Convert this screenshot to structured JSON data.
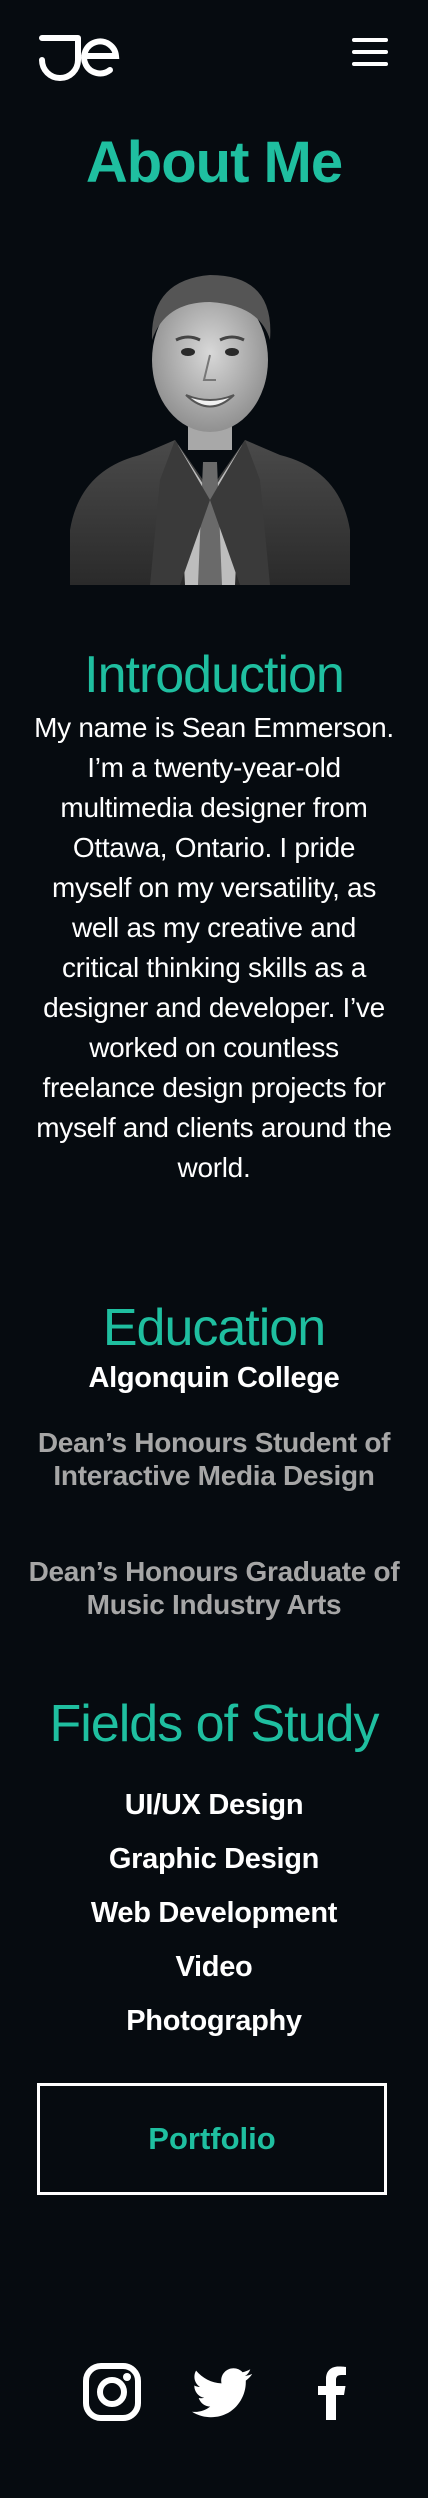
{
  "header": {
    "logo_text": "JE",
    "menu_icon": "hamburger-icon"
  },
  "page": {
    "title": "About Me"
  },
  "introduction": {
    "title": "Introduction",
    "body": "My name is Sean Emmerson. I’m a twenty-year-old multimedia designer from Ottawa, Ontario. I pride myself on my versatility, as well as my creative and critical thinking skills as a designer and developer. I’ve worked on countless freelance design projects for myself and clients around the world."
  },
  "education": {
    "title": "Education",
    "school": "Algonquin College",
    "items": [
      "Dean’s Honours Student of Interactive Media Design",
      "Dean’s Honours Graduate of Music Industry Arts"
    ]
  },
  "fields": {
    "title": "Fields of Study",
    "items": [
      "UI/UX Design",
      "Graphic Design",
      "Web Development",
      "Video",
      "Photography"
    ]
  },
  "portfolio_button": {
    "label": "Portfolio"
  },
  "social": {
    "icons": [
      "instagram-icon",
      "twitter-icon",
      "facebook-icon"
    ]
  },
  "colors": {
    "background": "#060b10",
    "accent": "#1fbfa0",
    "text": "#ffffff",
    "muted": "#a6a6a6"
  }
}
